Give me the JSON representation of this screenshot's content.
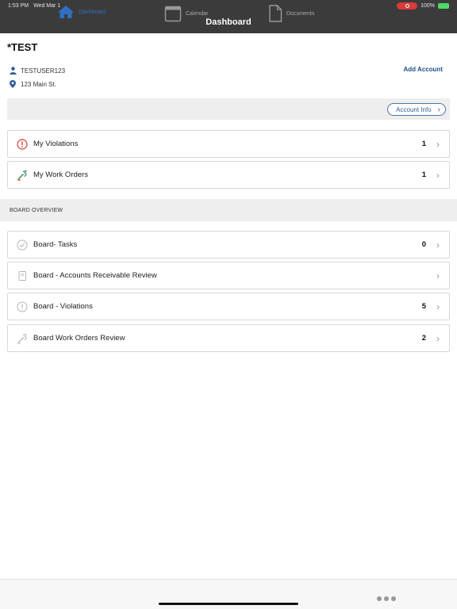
{
  "status_bar": {
    "time": "1:53 PM",
    "date": "Wed Mar 1",
    "battery": "100%"
  },
  "nav": {
    "title": "Dashboard"
  },
  "account": {
    "name": "*TEST",
    "user": "TESTUSER123",
    "address": "123 Main St.",
    "add_account_label": "Add Account",
    "account_info_label": "Account Info"
  },
  "my_items": [
    {
      "label": "My Violations",
      "count": "1",
      "icon": "alert-circle-icon"
    },
    {
      "label": "My Work Orders",
      "count": "1",
      "icon": "wrench-icon"
    }
  ],
  "board_section_title": "BOARD OVERVIEW",
  "board_items": [
    {
      "label": "Board- Tasks",
      "count": "0",
      "icon": "check-circle-icon"
    },
    {
      "label": "Board - Accounts Receivable Review",
      "count": "",
      "icon": "book-icon"
    },
    {
      "label": "Board - Violations",
      "count": "5",
      "icon": "alert-circle-icon"
    },
    {
      "label": "Board Work Orders Review",
      "count": "2",
      "icon": "wrench-icon"
    }
  ],
  "tabs": [
    {
      "label": "Dashboard",
      "icon": "home-icon"
    },
    {
      "label": "Calendar",
      "icon": "calendar-icon"
    },
    {
      "label": "Documents",
      "icon": "document-icon"
    }
  ],
  "colors": {
    "nav_bg": "#3b3b3b",
    "accent": "#2f6fc4",
    "link": "#1f4f8a",
    "alert": "#d93a3a",
    "wrench": "#2e8b57"
  }
}
